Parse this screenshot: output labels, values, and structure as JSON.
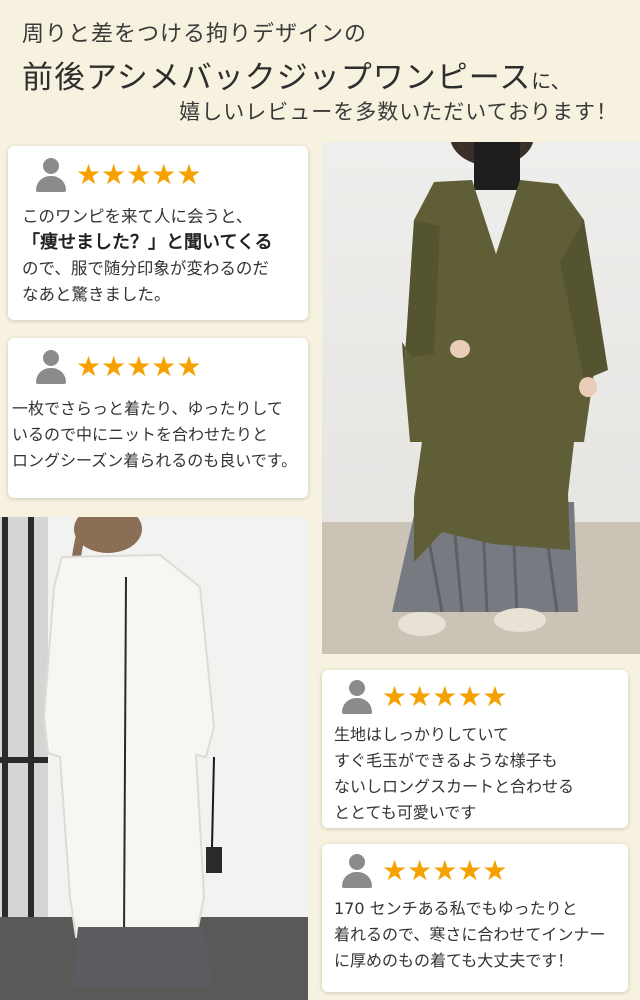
{
  "header": {
    "line1": "周りと差をつける拘りデザインの",
    "line2_main": "前後アシメバックジップワンピース",
    "line2_suffix": "に、",
    "line3": "嬉しいレビューを多数いただいております！"
  },
  "stars_text": "★★★★★",
  "reviews": [
    {
      "lines": [
        "このワンピを来て人に会うと、",
        "「痩せました？」と聞いてくる",
        "ので、服で随分印象が変わるのだ",
        "なあと驚きました。"
      ],
      "bold_line_index": 1
    },
    {
      "lines": [
        "一枚でさらっと着たり、ゆったりして",
        "いるので中にニットを合わせたりと",
        "ロングシーズン着られるのも良いです。"
      ]
    },
    {
      "lines": [
        "生地はしっかりしていて",
        "すぐ毛玉ができるような様子も",
        "ないしロングスカートと合わせる",
        "ととても可愛いです"
      ]
    },
    {
      "lines": [
        "170 センチある私でもゆったりと",
        "着れるので、寒さに合わせてインナー",
        "に厚めのもの着ても大丈夫です！"
      ]
    }
  ],
  "colors": {
    "background": "#f7f1df",
    "star": "#f5a100",
    "card": "#ffffff",
    "avatar": "#8b8b8b"
  }
}
